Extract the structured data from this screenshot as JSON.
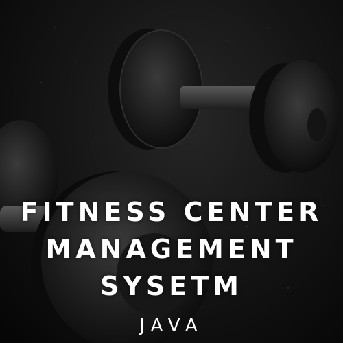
{
  "cover": {
    "title_lines": [
      "FITNESS CENTER",
      "MANAGEMENT",
      "SYSETM"
    ],
    "subtitle": "JAVA"
  },
  "colors": {
    "background": "#111111",
    "text": "#ffffff"
  }
}
